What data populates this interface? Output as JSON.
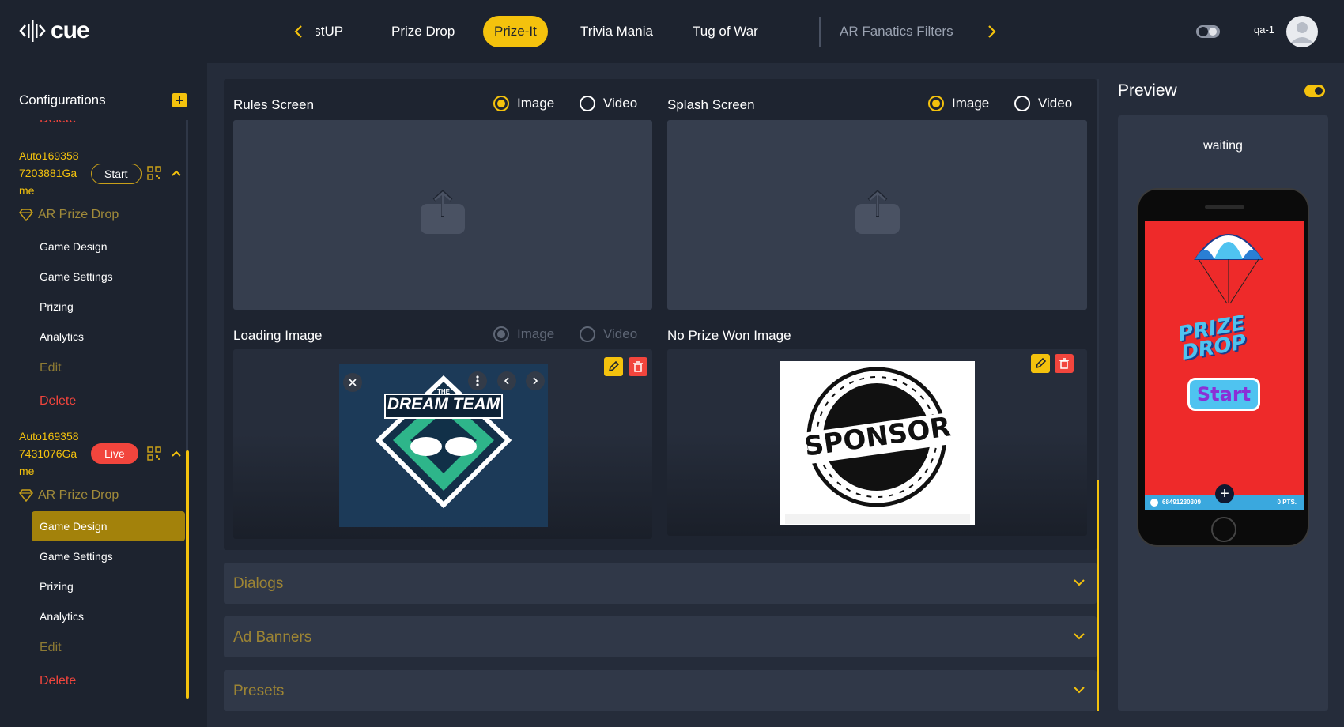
{
  "app": {
    "logo_text": "cue"
  },
  "tabs": [
    {
      "label": "BoostUP"
    },
    {
      "label": "Prize Drop"
    },
    {
      "label": "Prize-It"
    },
    {
      "label": "Trivia Mania"
    },
    {
      "label": "Tug of War"
    },
    {
      "label": "AR Fanatics Filters"
    }
  ],
  "header": {
    "username": "qa-1"
  },
  "sidebar": {
    "title": "Configurations",
    "top_delete_label": "Delete",
    "games": [
      {
        "name_lines": [
          "Auto169358",
          "7203881Ga",
          "me"
        ],
        "status": "Start",
        "type": "AR Prize Drop",
        "items": [
          "Game Design",
          "Game Settings",
          "Prizing",
          "Analytics"
        ],
        "edit_label": "Edit",
        "delete_label": "Delete"
      },
      {
        "name_lines": [
          "Auto169358",
          "7431076Ga",
          "me"
        ],
        "status": "Live",
        "type": "AR Prize Drop",
        "items": [
          "Game Design",
          "Game Settings",
          "Prizing",
          "Analytics"
        ],
        "active_item": "Game Design",
        "edit_label": "Edit",
        "delete_label": "Delete"
      }
    ]
  },
  "main": {
    "rules_screen": {
      "title": "Rules Screen",
      "options": [
        "Image",
        "Video"
      ],
      "selected": "Image"
    },
    "splash_screen": {
      "title": "Splash Screen",
      "options": [
        "Image",
        "Video"
      ],
      "selected": "Image"
    },
    "loading_image": {
      "title": "Loading Image",
      "options": [
        "Image",
        "Video"
      ],
      "selected": "Image",
      "disabled": true,
      "image_text": "DREAM TEAM",
      "image_subtext": "THE"
    },
    "no_prize_image": {
      "title": "No Prize Won Image",
      "image_text": "SPONSOR"
    },
    "accordions": [
      {
        "label": "Dialogs"
      },
      {
        "label": "Ad Banners"
      },
      {
        "label": "Presets"
      }
    ]
  },
  "preview": {
    "title": "Preview",
    "status": "waiting",
    "game_logo_lines": [
      "PRIZE",
      "DROP"
    ],
    "start_label": "Start",
    "player_id": "68491230309",
    "points": "0 PTS."
  },
  "colors": {
    "accent": "#f4c20d",
    "danger": "#f2453d",
    "bg": "#252c3a",
    "panel": "#1d232f"
  }
}
